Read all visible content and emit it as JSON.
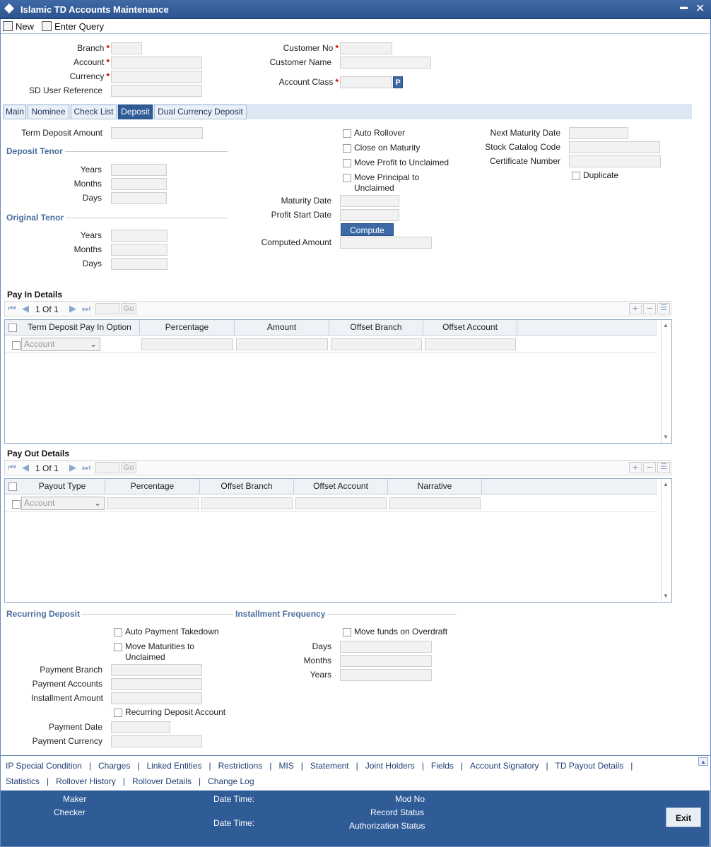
{
  "window": {
    "title": "Islamic TD Accounts Maintenance",
    "minimize": "▬",
    "close": "✕"
  },
  "toolbar": {
    "new_label": "New",
    "enter_query_label": "Enter Query"
  },
  "header": {
    "branch": "Branch",
    "account": "Account",
    "currency": "Currency",
    "sd_user_ref": "SD User Reference",
    "customer_no": "Customer No",
    "customer_name": "Customer Name",
    "account_class": "Account Class",
    "required_mark": "*",
    "p_button": "P"
  },
  "tabs": [
    {
      "label": "Main"
    },
    {
      "label": "Nominee"
    },
    {
      "label": "Check List"
    },
    {
      "label": "Deposit",
      "active": true
    },
    {
      "label": "Dual Currency Deposit"
    }
  ],
  "deposit": {
    "term_deposit_amount": "Term Deposit Amount",
    "deposit_tenor": "Deposit Tenor",
    "original_tenor": "Original Tenor",
    "years": "Years",
    "months": "Months",
    "days": "Days",
    "auto_rollover": "Auto Rollover",
    "close_on_maturity": "Close on Maturity",
    "move_profit": "Move Profit to Unclaimed",
    "move_principal_1": "Move Principal to",
    "move_principal_2": "Unclaimed",
    "maturity_date": "Maturity Date",
    "profit_start_date": "Profit Start Date",
    "compute": "Compute",
    "computed_amount": "Computed Amount",
    "next_maturity_date": "Next Maturity Date",
    "stock_catalog_code": "Stock Catalog Code",
    "certificate_number": "Certificate Number",
    "duplicate": "Duplicate"
  },
  "pay_in": {
    "title": "Pay In Details",
    "pager": "1 Of 1",
    "go": "Go",
    "columns": [
      "Term Deposit Pay In Option",
      "Percentage",
      "Amount",
      "Offset Branch",
      "Offset Account"
    ],
    "row_option": "Account"
  },
  "pay_out": {
    "title": "Pay Out Details",
    "pager": "1 Of 1",
    "go": "Go",
    "columns": [
      "Payout Type",
      "Percentage",
      "Offset Branch",
      "Offset Account",
      "Narrative"
    ],
    "row_option": "Account"
  },
  "recurring": {
    "title": "Recurring Deposit",
    "auto_payment": "Auto Payment Takedown",
    "move_maturities_1": "Move Maturities to",
    "move_maturities_2": "Unclaimed",
    "payment_branch": "Payment Branch",
    "payment_accounts": "Payment Accounts",
    "installment_amount": "Installment Amount",
    "recurring_account": "Recurring Deposit Account",
    "payment_date": "Payment Date",
    "payment_currency": "Payment Currency"
  },
  "installment": {
    "title": "Installment Frequency",
    "move_funds": "Move funds on Overdraft",
    "days": "Days",
    "months": "Months",
    "years": "Years"
  },
  "links_row1": [
    "IP Special Condition",
    "Charges",
    "Linked Entities",
    "Restrictions",
    "MIS",
    "Statement",
    "Joint Holders",
    "Fields",
    "Account Signatory",
    "TD Payout Details"
  ],
  "links_row2": [
    "Statistics",
    "Rollover History",
    "Rollover Details",
    "Change Log"
  ],
  "audit": {
    "maker": "Maker",
    "checker": "Checker",
    "date_time": "Date Time:",
    "mod_no": "Mod No",
    "record_status": "Record Status",
    "auth_status": "Authorization Status",
    "exit": "Exit"
  },
  "colors": {
    "accent": "#2f5b97",
    "required": "#cc0000"
  }
}
